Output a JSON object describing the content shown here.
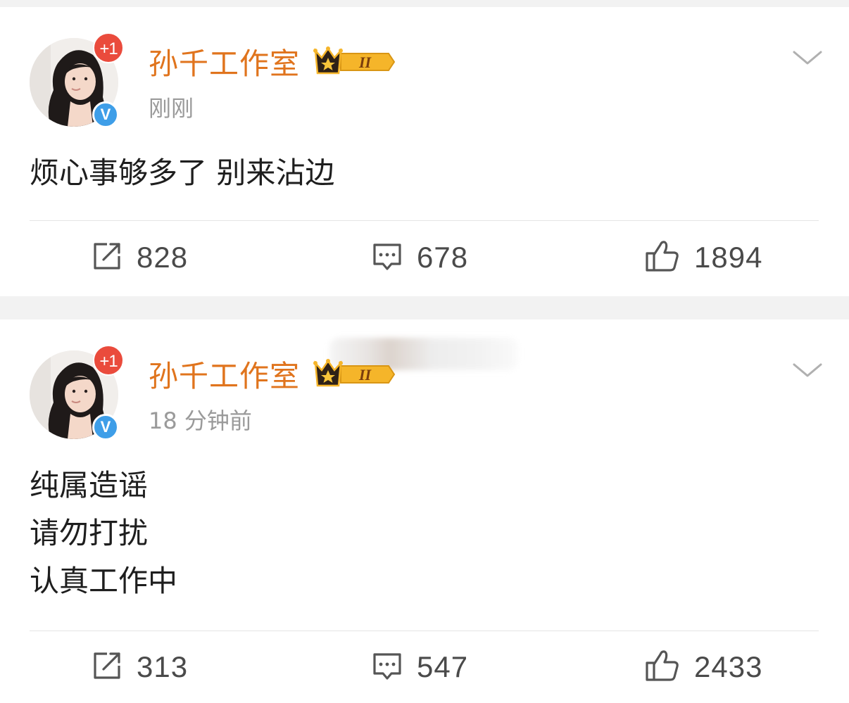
{
  "posts": [
    {
      "username": "孙千工作室",
      "notification_count": "+1",
      "verified_mark": "V",
      "vip_level": "II",
      "timestamp": "刚刚",
      "content": "烦心事够多了 别来沾边",
      "stats": {
        "reposts": "828",
        "comments": "678",
        "likes": "1894"
      }
    },
    {
      "username": "孙千工作室",
      "notification_count": "+1",
      "verified_mark": "V",
      "vip_level": "II",
      "timestamp": "18 分钟前",
      "content_lines": [
        "纯属造谣",
        "请勿打扰",
        "认真工作中"
      ],
      "stats": {
        "reposts": "313",
        "comments": "547",
        "likes": "2433"
      }
    }
  ],
  "colors": {
    "username": "#e0741d",
    "notification_badge": "#ea4b3c",
    "verified_badge": "#3e9ee8",
    "vip_gold": "#f5b52a",
    "timestamp": "#9a9a9a",
    "background": "#f2f2f2"
  },
  "icons": {
    "repost": "repost-icon",
    "comment": "comment-icon",
    "like": "thumbs-up-icon",
    "more": "chevron-down-icon",
    "vip": "crown-icon"
  }
}
